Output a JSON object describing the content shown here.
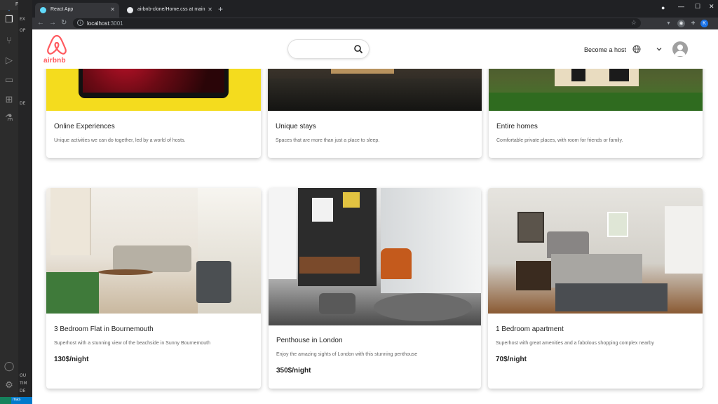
{
  "vscode": {
    "menu": [
      "File",
      "E"
    ],
    "side_rows": [
      "EX",
      "OP",
      "DE",
      "OU",
      "TIM",
      "DE"
    ],
    "status_branch": "mas"
  },
  "browser": {
    "tabs": [
      {
        "title": "React App",
        "active": true
      },
      {
        "title": "airbnb-clone/Home.css at main",
        "active": false
      }
    ],
    "url_host": "localhost",
    "url_port": ":3001",
    "profile_initial": "K"
  },
  "site": {
    "logo_text": "airbnb",
    "search_placeholder": "",
    "become_host": "Become a host",
    "brand_color": "#ff5a5f"
  },
  "top_cards": [
    {
      "title": "Online Experiences",
      "description": "Unique activities we can do together, led by a world of hosts."
    },
    {
      "title": "Unique stays",
      "description": "Spaces that are more than just a place to sleep."
    },
    {
      "title": "Entire homes",
      "description": "Comfortable private places, with room for friends or family."
    }
  ],
  "listings": [
    {
      "title": "3 Bedroom Flat in Bournemouth",
      "description": "Superhost with a stunning view of the beachside in Sunny Bournemouth",
      "price": "130$/night"
    },
    {
      "title": "Penthouse in London",
      "description": "Enjoy the amazing sights of London with this stunning penthouse",
      "price": "350$/night"
    },
    {
      "title": "1 Bedroom apartment",
      "description": "Superhost with great amenities and a fabolous shopping complex nearby",
      "price": "70$/night"
    }
  ]
}
